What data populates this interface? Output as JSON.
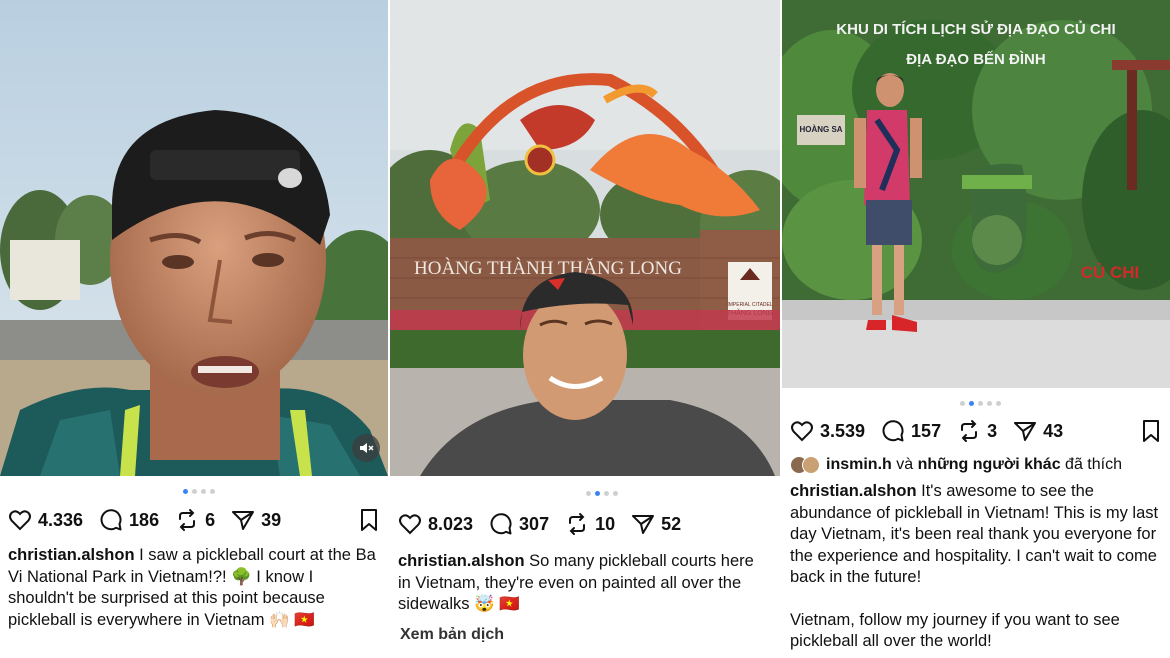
{
  "posts": [
    {
      "stats": {
        "likes": "4.336",
        "comments": "186",
        "reposts": "6",
        "shares": "39"
      },
      "username": "christian.alshon",
      "caption": "I saw a pickleball court at the Ba Vi National Park in Vietnam!?! 🌳 I know I shouldn't be surprised at this point because pickleball is everywhere in Vietnam 🙌🏻 🇻🇳",
      "carousel": {
        "count": 4,
        "active": 0
      }
    },
    {
      "stats": {
        "likes": "8.023",
        "comments": "307",
        "reposts": "10",
        "shares": "52"
      },
      "username": "christian.alshon",
      "caption": "So many pickleball courts here in Vietnam, they're even on painted all over the sidewalks 🤯 🇻🇳",
      "translate_label": "Xem bản dịch",
      "carousel": {
        "count": 4,
        "active": 1
      },
      "photo_text": {
        "sign": "HOÀNG THÀNH THĂNG LONG",
        "badge_line1": "IMPERIAL CITADEL",
        "badge_line2": "THĂNG LONG"
      }
    },
    {
      "stats": {
        "likes": "3.539",
        "comments": "157",
        "reposts": "3",
        "shares": "43"
      },
      "liked_by": {
        "user": "insmin.h",
        "connector": "và",
        "others": "những người khác",
        "suffix": "đã thích"
      },
      "username": "christian.alshon",
      "caption": "It's awesome to see the abundance of pickleball in Vietnam! This is my last day Vietnam, it's been real thank you everyone for the experience and hospitality. I can't wait to come back in the future!",
      "caption2": "Vietnam, follow my journey if you want to see pickleball all over the world!",
      "carousel": {
        "count": 5,
        "active": 1
      },
      "photo_text": {
        "banner1": "KHU DI TÍCH LỊCH SỬ ĐỊA ĐẠO CỦ CHI",
        "banner2": "ĐỊA ĐẠO BẾN ĐÌNH",
        "small_sign": "HOÀNG SA",
        "wall_label": "CỦ CHI"
      }
    }
  ],
  "colors": {
    "accent_dot": "#3b82f6",
    "text": "#111111"
  }
}
